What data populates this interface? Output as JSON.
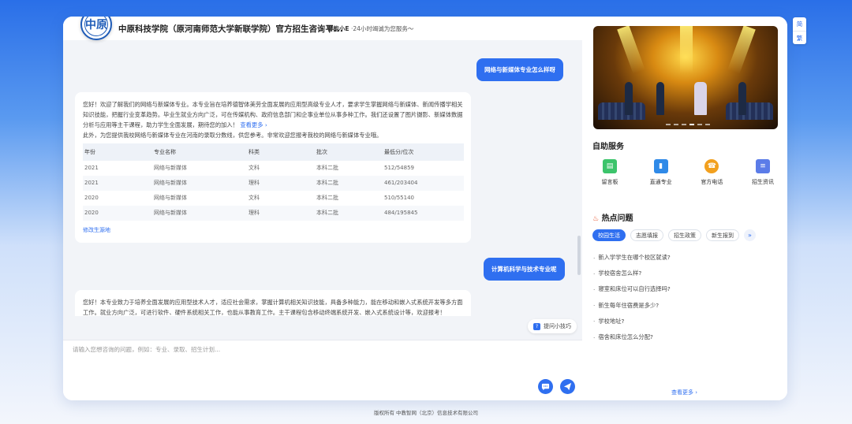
{
  "header": {
    "title": "中原科技学院（原河南师范大学新联学院）官方招生咨询平...",
    "assistant_name": "智能小E",
    "assistant_tagline": "·24小时竭诚为您服务～",
    "logo_text": "中原"
  },
  "messages": {
    "q1": "网络与新媒体专业怎么样呀",
    "a1_text": "您好！欢迎了解我们的网络与新媒体专业。本专业旨在培养德智体美劳全面发展的应用型高级专业人才，要求学生掌握网络与新媒体、新闻传播学相关知识技能，把握行业变革趋势。毕业生就业方向广泛，可在传媒机构、政府信息部门和企事业单位从事多种工作。我们还设置了图片摄影、新媒体数据分析与应用等主干课程，助力学生全面发展，期待您的加入！",
    "a1_more": "查看更多 ›",
    "a1_note": "此外，为您提供我校网络与新媒体专业在河南的录取分数线，供您参考。非常欢迎您报考我校的网络与新媒体专业哦。",
    "table": {
      "headers": [
        "年份",
        "专业名称",
        "科类",
        "批次",
        "最低分/位次"
      ],
      "rows": [
        [
          "2021",
          "网络与新媒体",
          "文科",
          "本科二批",
          "512/54859"
        ],
        [
          "2021",
          "网络与新媒体",
          "理科",
          "本科二批",
          "461/203404"
        ],
        [
          "2020",
          "网络与新媒体",
          "文科",
          "本科二批",
          "510/55140"
        ],
        [
          "2020",
          "网络与新媒体",
          "理科",
          "本科二批",
          "484/195845"
        ]
      ]
    },
    "modify_origin": "修改生源地",
    "q2": "计算机科学与技术专业呢",
    "a2_text": "您好！本专业致力于培养全面发展的应用型技术人才，适应社会需求，掌握计算机相关知识技能，具备多种能力，能在移动和嵌入式系统开发等多方面工作。就业方向广泛，可进行软件、硬件系统相关工作，也能从事教育工作。主干课程包含移动终端系统开发、嵌入式系统设计等，欢迎报考！"
  },
  "tips_label": "提问小技巧",
  "tips_icon": "?",
  "input": {
    "placeholder": "请输入您想咨询的问题，例如：专业、录取、招生计划..."
  },
  "self_service": {
    "title": "自助服务",
    "items": [
      {
        "label": "留言板",
        "icon": "message-board-icon",
        "color": "#3cc46b"
      },
      {
        "label": "直通专业",
        "icon": "major-icon",
        "color": "#2f8ae8"
      },
      {
        "label": "官方电话",
        "icon": "phone-icon",
        "color": "#f2a01e"
      },
      {
        "label": "招生资讯",
        "icon": "news-icon",
        "color": "#5b7ce8"
      }
    ]
  },
  "hot": {
    "title": "热点问题",
    "tabs": [
      "校园生活",
      "志愿填报",
      "招生政策",
      "新生报到"
    ],
    "questions": [
      "新入学学生在哪个校区就读?",
      "学校宿舍怎么样?",
      "寝室和床位可以自行选择吗?",
      "新生每年住宿费是多少?",
      "学校地址?",
      "宿舍和床位怎么分配?"
    ],
    "see_more": "查看更多 ›"
  },
  "lang": {
    "simplified": "简",
    "traditional": "繁"
  },
  "footer": "版权所有 中教智网（北京）信息技术有限公司"
}
